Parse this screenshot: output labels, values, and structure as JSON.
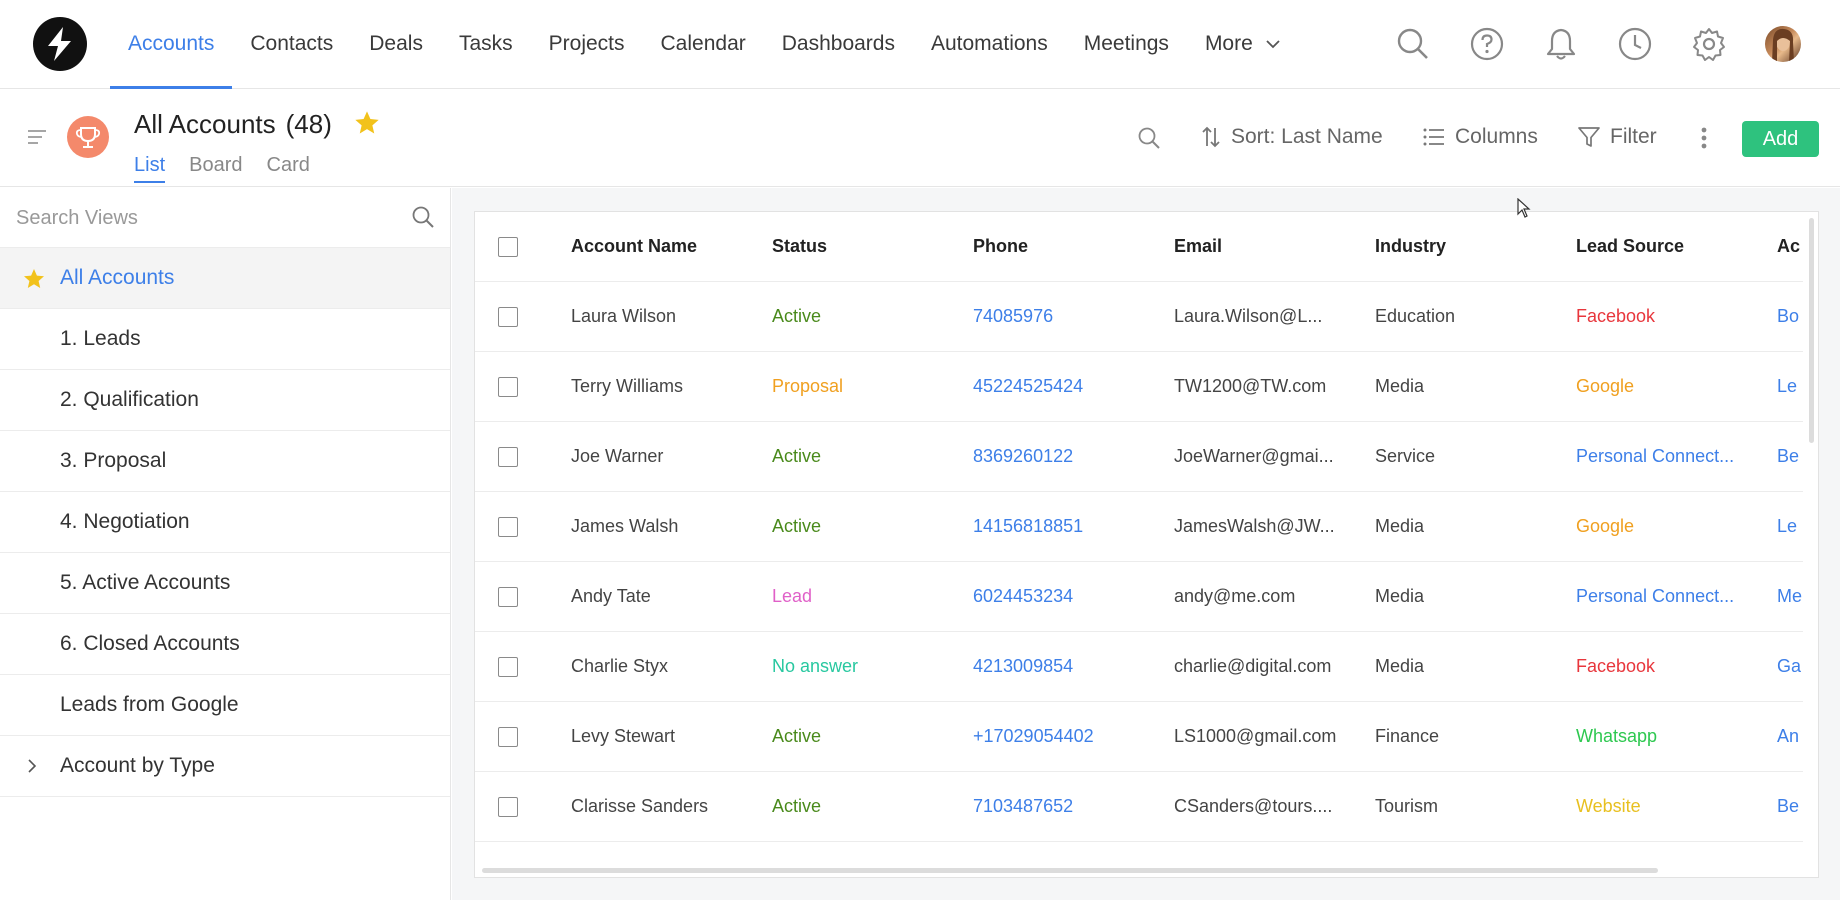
{
  "topnav": {
    "items": [
      {
        "label": "Accounts",
        "active": true
      },
      {
        "label": "Contacts"
      },
      {
        "label": "Deals"
      },
      {
        "label": "Tasks"
      },
      {
        "label": "Projects"
      },
      {
        "label": "Calendar"
      },
      {
        "label": "Dashboards"
      },
      {
        "label": "Automations"
      },
      {
        "label": "Meetings"
      }
    ],
    "more_label": "More",
    "icons": [
      "search-icon",
      "help-icon",
      "bell-icon",
      "clock-icon",
      "gear-icon",
      "avatar"
    ]
  },
  "header": {
    "title": "All Accounts",
    "count": "(48)",
    "views": [
      "List",
      "Board",
      "Card"
    ],
    "active_view": "List",
    "sort_label": "Sort: Last Name",
    "columns_label": "Columns",
    "filter_label": "Filter",
    "add_label": "Add"
  },
  "sidebar": {
    "search_placeholder": "Search Views",
    "items": [
      {
        "label": "All Accounts",
        "active": true,
        "starred": true
      },
      {
        "label": "1. Leads"
      },
      {
        "label": "2. Qualification"
      },
      {
        "label": "3. Proposal"
      },
      {
        "label": "4. Negotiation"
      },
      {
        "label": "5. Active Accounts"
      },
      {
        "label": "6. Closed Accounts"
      },
      {
        "label": "Leads from Google"
      },
      {
        "label": "Account by Type",
        "expandable": true
      }
    ]
  },
  "table": {
    "columns": [
      "Account Name",
      "Status",
      "Phone",
      "Email",
      "Industry",
      "Lead Source",
      "Ac"
    ],
    "rows": [
      {
        "name": "Laura Wilson",
        "status": "Active",
        "phone": "74085976",
        "email": "Laura.Wilson@L...",
        "industry": "Education",
        "lead_source": "Facebook",
        "acc": "Bo"
      },
      {
        "name": "Terry Williams",
        "status": "Proposal",
        "phone": "45224525424",
        "email": "TW1200@TW.com",
        "industry": "Media",
        "lead_source": "Google",
        "acc": "Le"
      },
      {
        "name": "Joe Warner",
        "status": "Active",
        "phone": "8369260122",
        "email": "JoeWarner@gmai...",
        "industry": "Service",
        "lead_source": "Personal Connect...",
        "acc": "Be"
      },
      {
        "name": "James Walsh",
        "status": "Active",
        "phone": "14156818851",
        "email": "JamesWalsh@JW...",
        "industry": "Media",
        "lead_source": "Google",
        "acc": "Le"
      },
      {
        "name": "Andy Tate",
        "status": "Lead",
        "phone": "6024453234",
        "email": "andy@me.com",
        "industry": "Media",
        "lead_source": "Personal Connect...",
        "acc": "Me"
      },
      {
        "name": "Charlie Styx",
        "status": "No answer",
        "phone": "4213009854",
        "email": "charlie@digital.com",
        "industry": "Media",
        "lead_source": "Facebook",
        "acc": "Ga"
      },
      {
        "name": "Levy Stewart",
        "status": "Active",
        "phone": "+17029054402",
        "email": "LS1000@gmail.com",
        "industry": "Finance",
        "lead_source": "Whatsapp",
        "acc": "An"
      },
      {
        "name": "Clarisse Sanders",
        "status": "Active",
        "phone": "7103487652",
        "email": "CSanders@tours....",
        "industry": "Tourism",
        "lead_source": "Website",
        "acc": "Be"
      }
    ]
  },
  "colors": {
    "accent": "#3d7fe8",
    "add_button": "#2ec27e",
    "status": {
      "Active": "#4a8a1c",
      "Proposal": "#f0a020",
      "Lead": "#e060c8",
      "No answer": "#28c8a0"
    },
    "lead_source": {
      "Facebook": "#e8363c",
      "Google": "#f0a020",
      "Personal Connect...": "#3d7fe8",
      "Whatsapp": "#2ec850",
      "Website": "#e8c020"
    },
    "star": "#f2c21b",
    "trophy_bg": "#f4896b"
  }
}
